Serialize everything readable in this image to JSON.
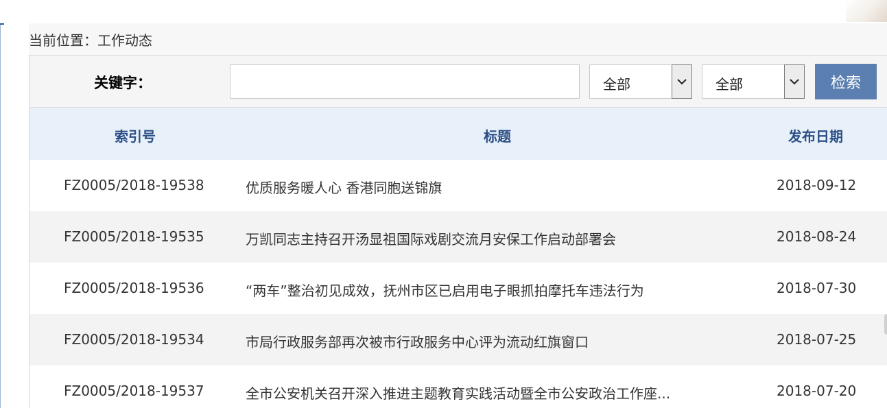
{
  "breadcrumb": {
    "text": "当前位置：工作动态"
  },
  "search": {
    "keyword_label": "关键字：",
    "keyword_value": "",
    "select1_value": "全部",
    "select2_value": "全部",
    "button_label": "检索"
  },
  "table": {
    "headers": {
      "index": "索引号",
      "title": "标题",
      "date": "发布日期"
    },
    "rows": [
      {
        "index": "FZ0005/2018-19538",
        "title": "优质服务暖人心 香港同胞送锦旗",
        "date": "2018-09-12"
      },
      {
        "index": "FZ0005/2018-19535",
        "title": "万凯同志主持召开汤显祖国际戏剧交流月安保工作启动部署会",
        "date": "2018-08-24"
      },
      {
        "index": "FZ0005/2018-19536",
        "title": "“两车”整治初见成效，抚州市区已启用电子眼抓拍摩托车违法行为",
        "date": "2018-07-30"
      },
      {
        "index": "FZ0005/2018-19534",
        "title": "市局行政服务部再次被市行政服务中心评为流动红旗窗口",
        "date": "2018-07-25"
      },
      {
        "index": "FZ0005/2018-19537",
        "title": "全市公安机关召开深入推进主题教育实践活动暨全市公安政治工作座...",
        "date": "2018-07-20"
      }
    ]
  },
  "colors": {
    "header_text": "#2b4e85",
    "header_bg": "#e8f0fa",
    "button_bg": "#5b7fb0",
    "alt_row_bg": "#f3f3f3"
  }
}
